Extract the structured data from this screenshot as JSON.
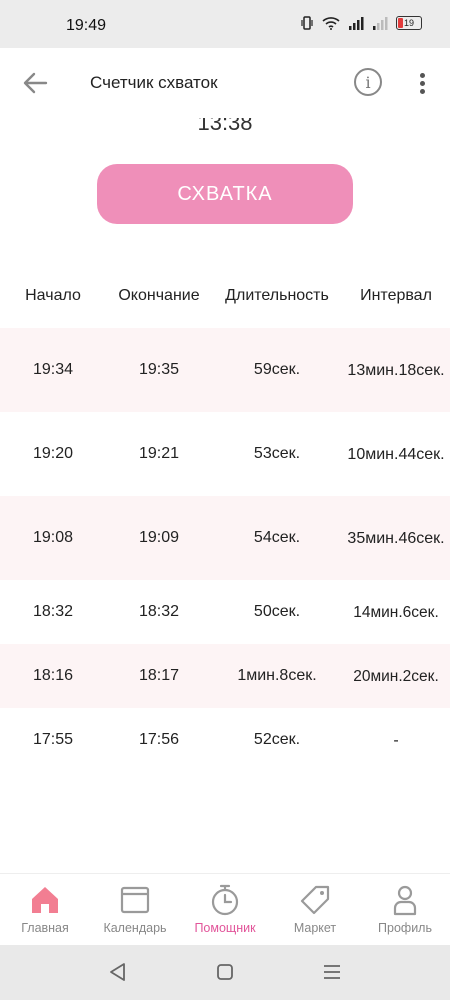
{
  "status_bar": {
    "time": "19:49",
    "battery": "19"
  },
  "app_bar": {
    "title": "Счетчик схваток",
    "info_icon": "info-icon",
    "more_icon": "more-vert-icon",
    "back_icon": "arrow-back-icon"
  },
  "timer": {
    "value": "13:38"
  },
  "contraction_button": {
    "label": "СХВАТКА",
    "color": "#ef8fb9"
  },
  "table": {
    "headers": [
      "Начало",
      "Окончание",
      "Длительность",
      "Интервал"
    ],
    "rows": [
      {
        "start": "19:34",
        "end": "19:35",
        "duration": "59сек.",
        "interval": "13мин.18сек."
      },
      {
        "start": "19:20",
        "end": "19:21",
        "duration": "53сек.",
        "interval": "10мин.44сек."
      },
      {
        "start": "19:08",
        "end": "19:09",
        "duration": "54сек.",
        "interval": "35мин.46сек."
      },
      {
        "start": "18:32",
        "end": "18:32",
        "duration": "50сек.",
        "interval": "14мин.6сек."
      },
      {
        "start": "18:16",
        "end": "18:17",
        "duration": "1мин.8сек.",
        "interval": "20мин.2сек."
      },
      {
        "start": "17:55",
        "end": "17:56",
        "duration": "52сек.",
        "interval": "-"
      }
    ]
  },
  "bottom_nav": {
    "items": [
      {
        "label": "Главная",
        "icon": "home-icon",
        "active": false
      },
      {
        "label": "Календарь",
        "icon": "calendar-icon",
        "active": false
      },
      {
        "label": "Помощник",
        "icon": "timer-icon",
        "active": true
      },
      {
        "label": "Маркет",
        "icon": "tag-icon",
        "active": false
      },
      {
        "label": "Профиль",
        "icon": "profile-icon",
        "active": false
      }
    ]
  },
  "colors": {
    "accent": "#ef8fb9",
    "active_nav": "#e2559a",
    "home_icon": "#f27e92",
    "row_shade": "#fdf4f5"
  }
}
